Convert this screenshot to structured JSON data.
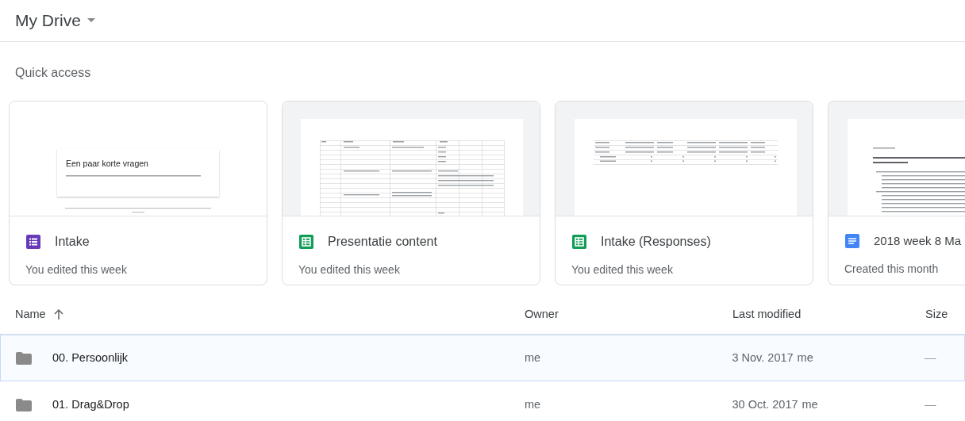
{
  "header": {
    "title": "My Drive"
  },
  "quick_access": {
    "title": "Quick access",
    "cards": [
      {
        "kind": "form",
        "preview": {
          "kind": "form",
          "title": "Een paar korte vragen"
        },
        "name": "Intake",
        "subtitle": "You edited this week"
      },
      {
        "kind": "sheet",
        "preview": {
          "kind": "sheet"
        },
        "name": "Presentatie content",
        "subtitle": "You edited this week"
      },
      {
        "kind": "sheet",
        "preview": {
          "kind": "table"
        },
        "name": "Intake (Responses)",
        "subtitle": "You edited this week"
      },
      {
        "kind": "doc",
        "preview": {
          "kind": "doc"
        },
        "name": "2018 week 8 Ma",
        "subtitle": "Created this month"
      }
    ]
  },
  "table": {
    "columns": [
      {
        "label": "Name",
        "sorted_ascending": true
      },
      {
        "label": "Owner"
      },
      {
        "label": "Last modified"
      },
      {
        "label": "Size"
      }
    ],
    "rows": [
      {
        "name": "00. Persoonlijk",
        "owner": "me",
        "modified": "3 Nov. 2017",
        "modified_by": "me",
        "size": "—",
        "selected": true
      },
      {
        "name": "01. Drag&Drop",
        "owner": "me",
        "modified": "30 Oct. 2017",
        "modified_by": "me",
        "size": "—",
        "selected": false
      }
    ]
  }
}
